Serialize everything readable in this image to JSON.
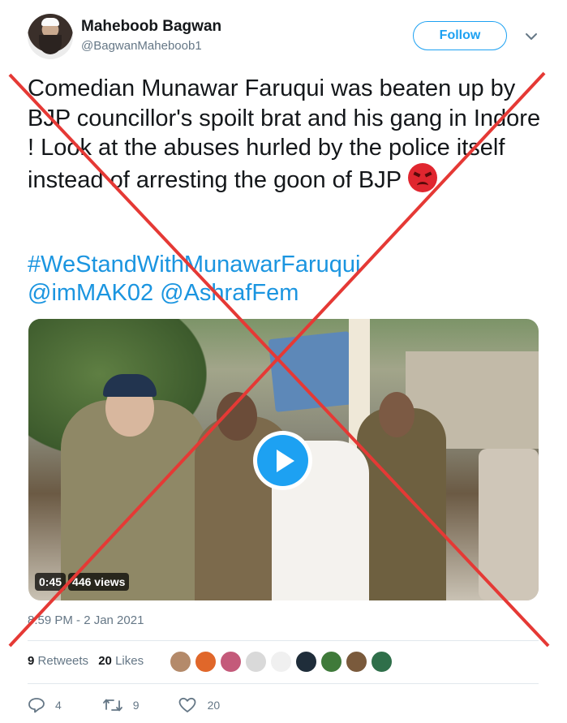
{
  "author": {
    "name": "Maheboob Bagwan",
    "handle": "@BagwanMaheboob1"
  },
  "follow_label": "Follow",
  "tweet": {
    "text": "Comedian Munawar Faruqui was beaten up by BJP councillor's spoilt brat and his gang in Indore  ! Look at the abuses hurled by the police itself instead of arresting the goon of BJP",
    "emoji": "angry-face-emoji",
    "hashtag": "#WeStandWithMunawarFaruqui",
    "mentions": [
      "@imMAK02",
      "@AshrafFem"
    ]
  },
  "video": {
    "duration": "0:45",
    "views": "446 views"
  },
  "timestamp": "8:59 PM - 2 Jan 2021",
  "stats": {
    "retweets_count": "9",
    "retweets_label": "Retweets",
    "likes_count": "20",
    "likes_label": "Likes"
  },
  "actions": {
    "reply_count": "4",
    "retweet_count": "9",
    "like_count": "20"
  },
  "colors": {
    "accent": "#1da1f2",
    "link": "#1b95e0",
    "overlay_x": "#e53935",
    "muted": "#657786"
  }
}
